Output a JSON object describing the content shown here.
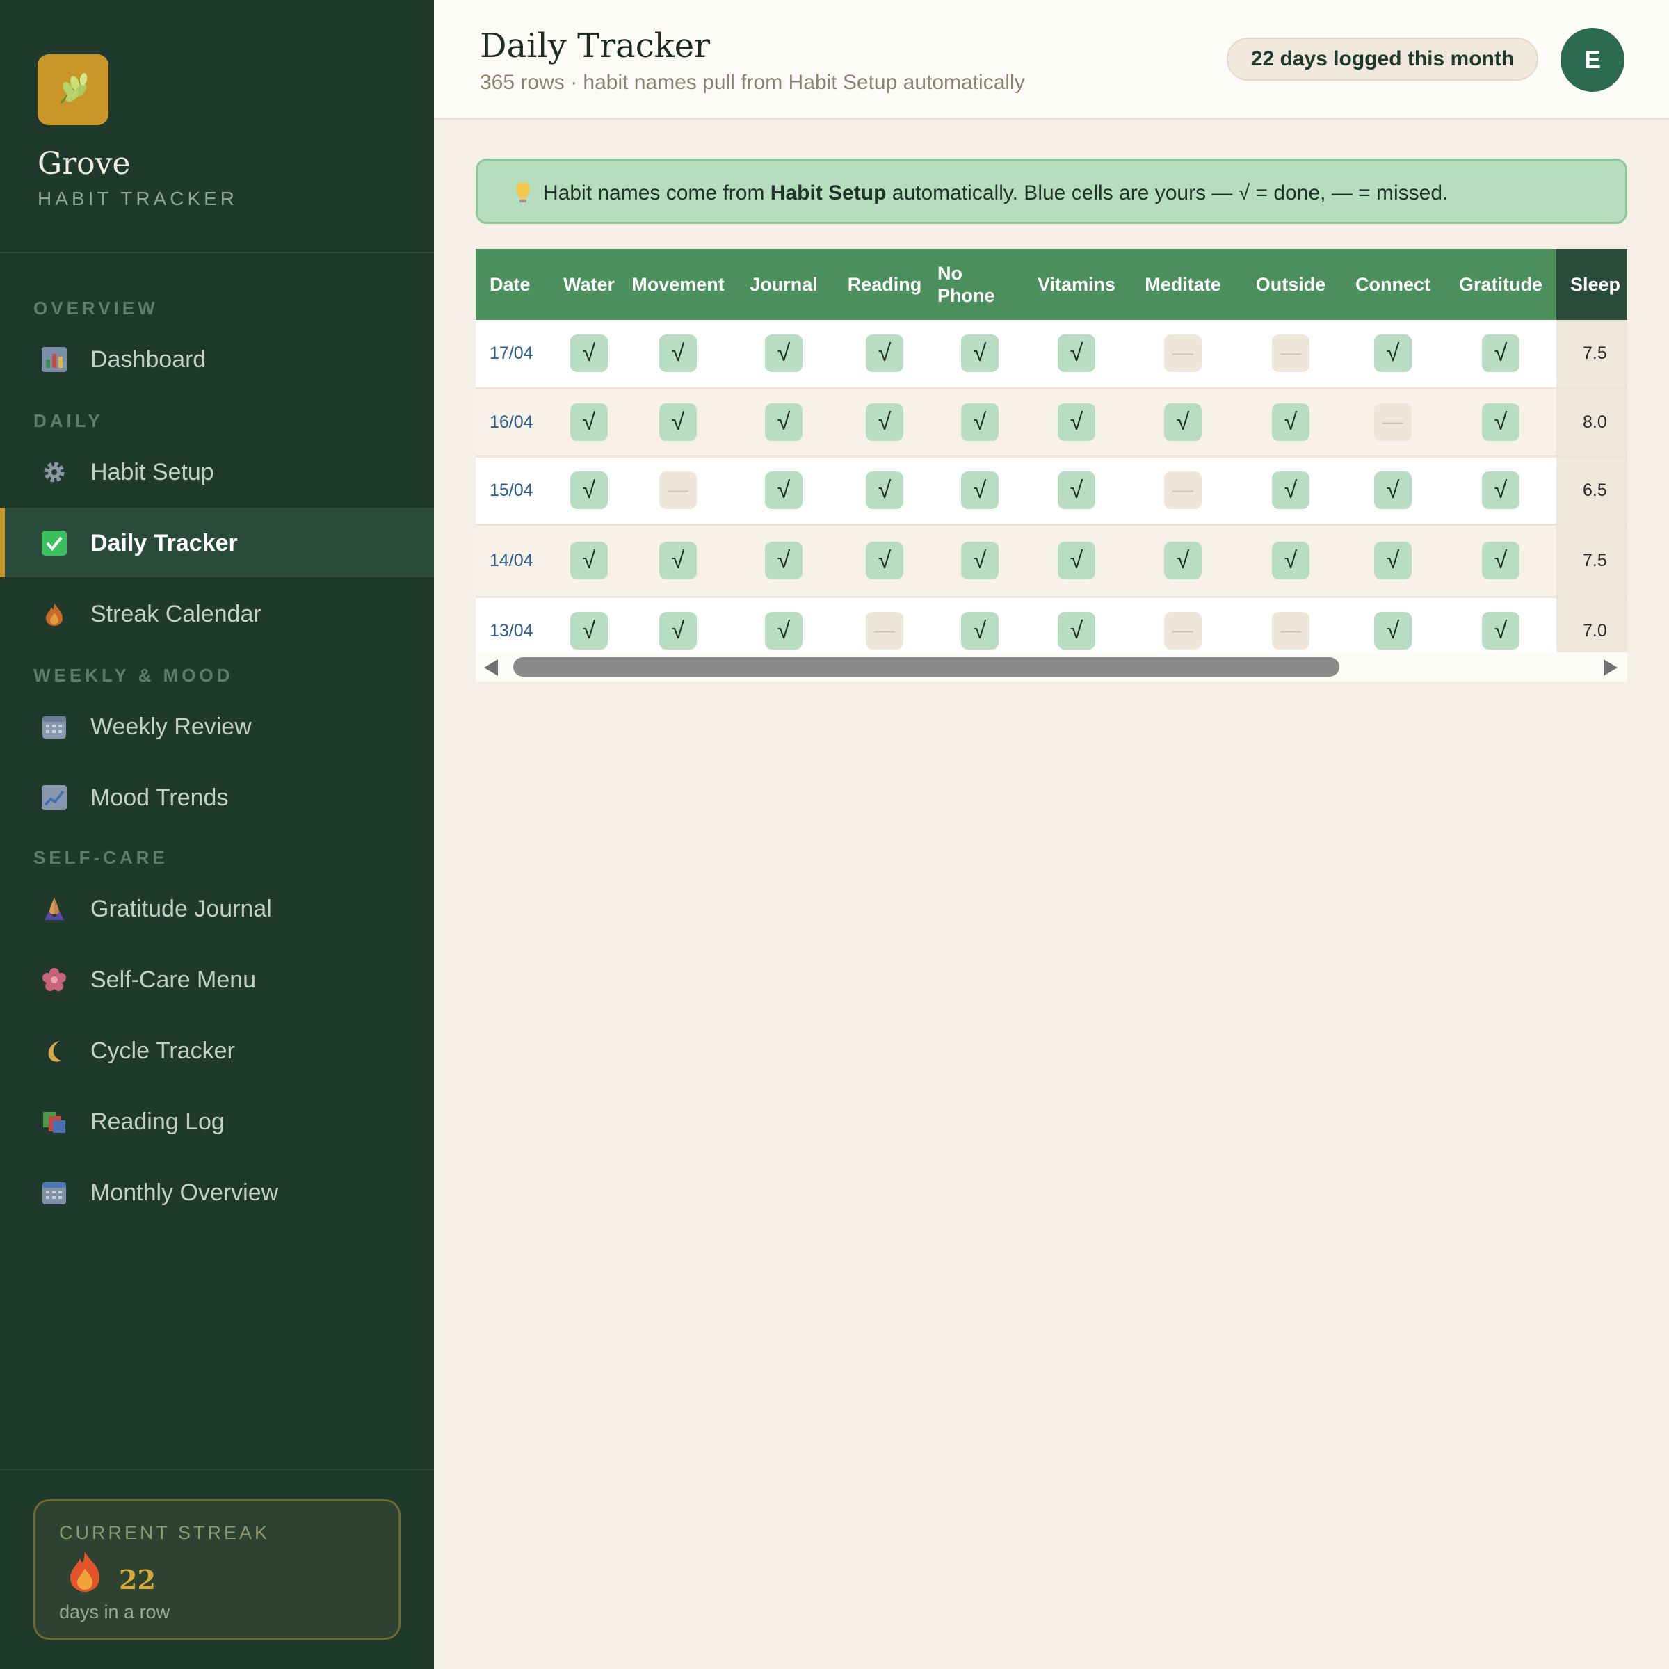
{
  "brand": {
    "name": "Grove",
    "subtitle": "HABIT TRACKER",
    "icon": "leaf-icon"
  },
  "nav": {
    "sections": [
      {
        "title": "OVERVIEW",
        "items": [
          {
            "label": "Dashboard",
            "icon": "bar-chart-icon"
          }
        ]
      },
      {
        "title": "DAILY",
        "items": [
          {
            "label": "Habit Setup",
            "icon": "gear-icon"
          },
          {
            "label": "Daily Tracker",
            "icon": "checkbox-icon",
            "active": true
          },
          {
            "label": "Streak Calendar",
            "icon": "flame-icon"
          }
        ]
      },
      {
        "title": "WEEKLY & MOOD",
        "items": [
          {
            "label": "Weekly Review",
            "icon": "calendar-icon"
          },
          {
            "label": "Mood Trends",
            "icon": "trend-chart-icon"
          }
        ]
      },
      {
        "title": "SELF-CARE",
        "items": [
          {
            "label": "Gratitude Journal",
            "icon": "praying-hands-icon"
          },
          {
            "label": "Self-Care Menu",
            "icon": "flower-icon"
          },
          {
            "label": "Cycle Tracker",
            "icon": "moon-icon"
          },
          {
            "label": "Reading Log",
            "icon": "books-icon"
          },
          {
            "label": "Monthly Overview",
            "icon": "calendar-grid-icon"
          }
        ]
      }
    ]
  },
  "streak": {
    "label": "CURRENT STREAK",
    "value": "22",
    "sub": "days in a row",
    "icon": "flame-icon"
  },
  "header": {
    "title": "Daily Tracker",
    "subtitle": "365 rows · habit names pull from Habit Setup automatically",
    "badge": "22 days logged this month",
    "avatar": "E"
  },
  "banner": {
    "icon": "lightbulb-icon",
    "text_before": "Habit names come from ",
    "text_bold": "Habit Setup",
    "text_after": " automatically. Blue cells are yours — √ = done, — = missed."
  },
  "table": {
    "columns": [
      "Date",
      "Water",
      "Movement",
      "Journal",
      "Reading",
      "No Phone",
      "Vitamins",
      "Meditate",
      "Outside",
      "Connect",
      "Gratitude",
      "Sleep"
    ],
    "done_symbol": "√",
    "missed_symbol": "—",
    "rows": [
      {
        "date": "17/04",
        "cells": [
          1,
          1,
          1,
          1,
          1,
          1,
          0,
          0,
          1,
          1
        ],
        "sleep": "7.5"
      },
      {
        "date": "16/04",
        "cells": [
          1,
          1,
          1,
          1,
          1,
          1,
          1,
          1,
          0,
          1
        ],
        "sleep": "8.0"
      },
      {
        "date": "15/04",
        "cells": [
          1,
          0,
          1,
          1,
          1,
          1,
          0,
          1,
          1,
          1
        ],
        "sleep": "6.5"
      },
      {
        "date": "14/04",
        "cells": [
          1,
          1,
          1,
          1,
          1,
          1,
          1,
          1,
          1,
          1
        ],
        "sleep": "7.5"
      },
      {
        "date": "13/04",
        "cells": [
          1,
          1,
          1,
          0,
          1,
          1,
          0,
          0,
          1,
          1
        ],
        "sleep": "7.0"
      }
    ]
  },
  "colors": {
    "sidebar": "#1f3a2d",
    "accent": "#c9962a",
    "header_green": "#4a8f5c",
    "done_cell": "#b8ddc2",
    "missed_cell": "#efe6da"
  }
}
